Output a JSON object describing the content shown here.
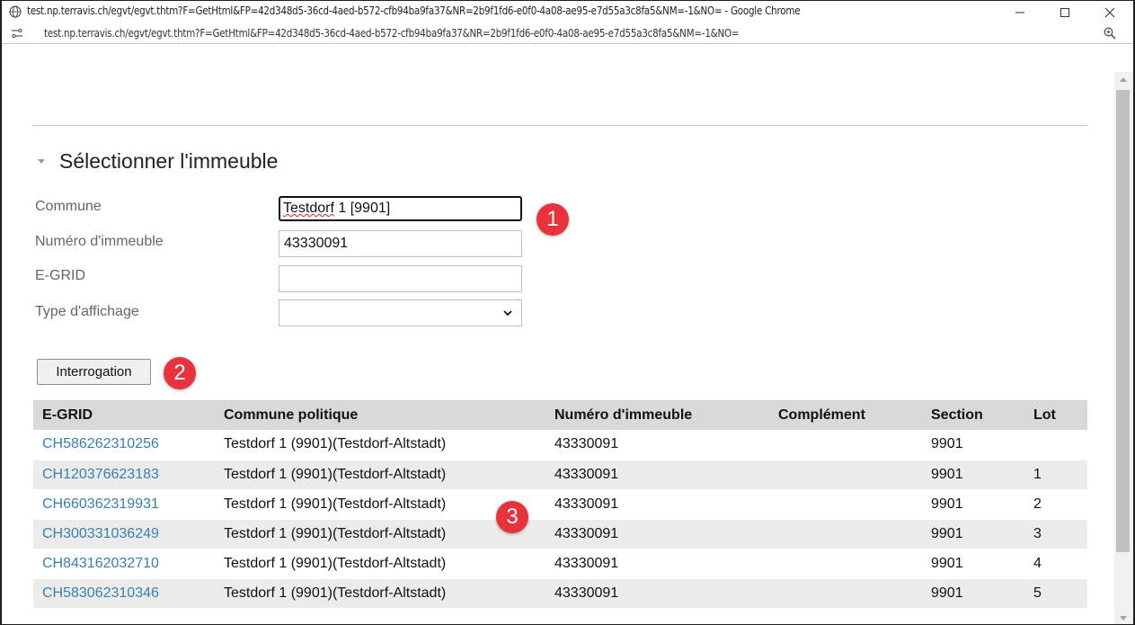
{
  "window": {
    "title": "test.np.terravis.ch/egvt/egvt.thtm?F=GetHtml&FP=42d348d5-36cd-4aed-b572-cfb94ba9fa37&NR=2b9f1fd6-e0f0-4a08-ae95-e7d55a3c8fa5&NM=-1&NO= - Google Chrome",
    "url": "test.np.terravis.ch/egvt/egvt.thtm?F=GetHtml&FP=42d348d5-36cd-4aed-b572-cfb94ba9fa37&NR=2b9f1fd6-e0f0-4a08-ae95-e7d55a3c8fa5&NM=-1&NO="
  },
  "section": {
    "title": "Sélectionner l'immeuble"
  },
  "form": {
    "commune_label": "Commune",
    "commune_value": "Testdorf 1 [9901]",
    "commune_word1": "Testdorf",
    "commune_rest": " 1 [9901]",
    "numero_label": "Numéro d'immeuble",
    "numero_value": "43330091",
    "egrid_label": "E-GRID",
    "egrid_value": "",
    "type_label": "Type d'affichage",
    "type_value": ""
  },
  "query_button": "Interrogation",
  "badges": [
    "1",
    "2",
    "3"
  ],
  "table": {
    "headers": [
      "E-GRID",
      "Commune politique",
      "Numéro d'immeuble",
      "Complément",
      "Section",
      "Lot"
    ],
    "rows": [
      [
        "CH586262310256",
        "Testdorf 1 (9901)(Testdorf-Altstadt)",
        "43330091",
        "",
        "9901",
        ""
      ],
      [
        "CH120376623183",
        "Testdorf 1 (9901)(Testdorf-Altstadt)",
        "43330091",
        "",
        "9901",
        "1"
      ],
      [
        "CH660362319931",
        "Testdorf 1 (9901)(Testdorf-Altstadt)",
        "43330091",
        "",
        "9901",
        "2"
      ],
      [
        "CH300331036249",
        "Testdorf 1 (9901)(Testdorf-Altstadt)",
        "43330091",
        "",
        "9901",
        "3"
      ],
      [
        "CH843162032710",
        "Testdorf 1 (9901)(Testdorf-Altstadt)",
        "43330091",
        "",
        "9901",
        "4"
      ],
      [
        "CH583062310346",
        "Testdorf 1 (9901)(Testdorf-Altstadt)",
        "43330091",
        "",
        "9901",
        "5"
      ]
    ]
  },
  "colors": {
    "link": "#3a7fb0",
    "badge": "#e8323c",
    "header_bg": "#d9d9d9",
    "row_alt_bg": "#ececec"
  },
  "icons": {
    "window": "globe-icon",
    "site_info": "site-settings-icon",
    "zoom": "zoom-icon",
    "section_toggle": "collapse-triangle-icon",
    "select": "chevron-down-icon"
  }
}
